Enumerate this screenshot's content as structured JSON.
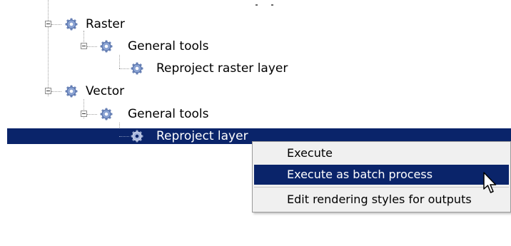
{
  "tree": {
    "items": [
      {
        "label": "Raster",
        "expanded": true
      },
      {
        "label": "General tools",
        "expanded": true
      },
      {
        "label": "Reproject raster layer"
      },
      {
        "label": "Vector",
        "expanded": true
      },
      {
        "label": "General tools",
        "expanded": true
      },
      {
        "label": "Reproject layer",
        "selected": true
      }
    ]
  },
  "context_menu": {
    "items": [
      {
        "label": "Execute"
      },
      {
        "label": "Execute as batch process",
        "highlighted": true
      },
      {
        "label": "Edit rendering styles for outputs"
      }
    ]
  },
  "colors": {
    "selection": "#0a246a",
    "gear": "#6e86b8",
    "menu_background": "#f0f0f0"
  },
  "icons": {
    "expander": "minus-box-icon",
    "algorithm": "gear-icon",
    "pointer": "mouse-cursor-icon"
  }
}
